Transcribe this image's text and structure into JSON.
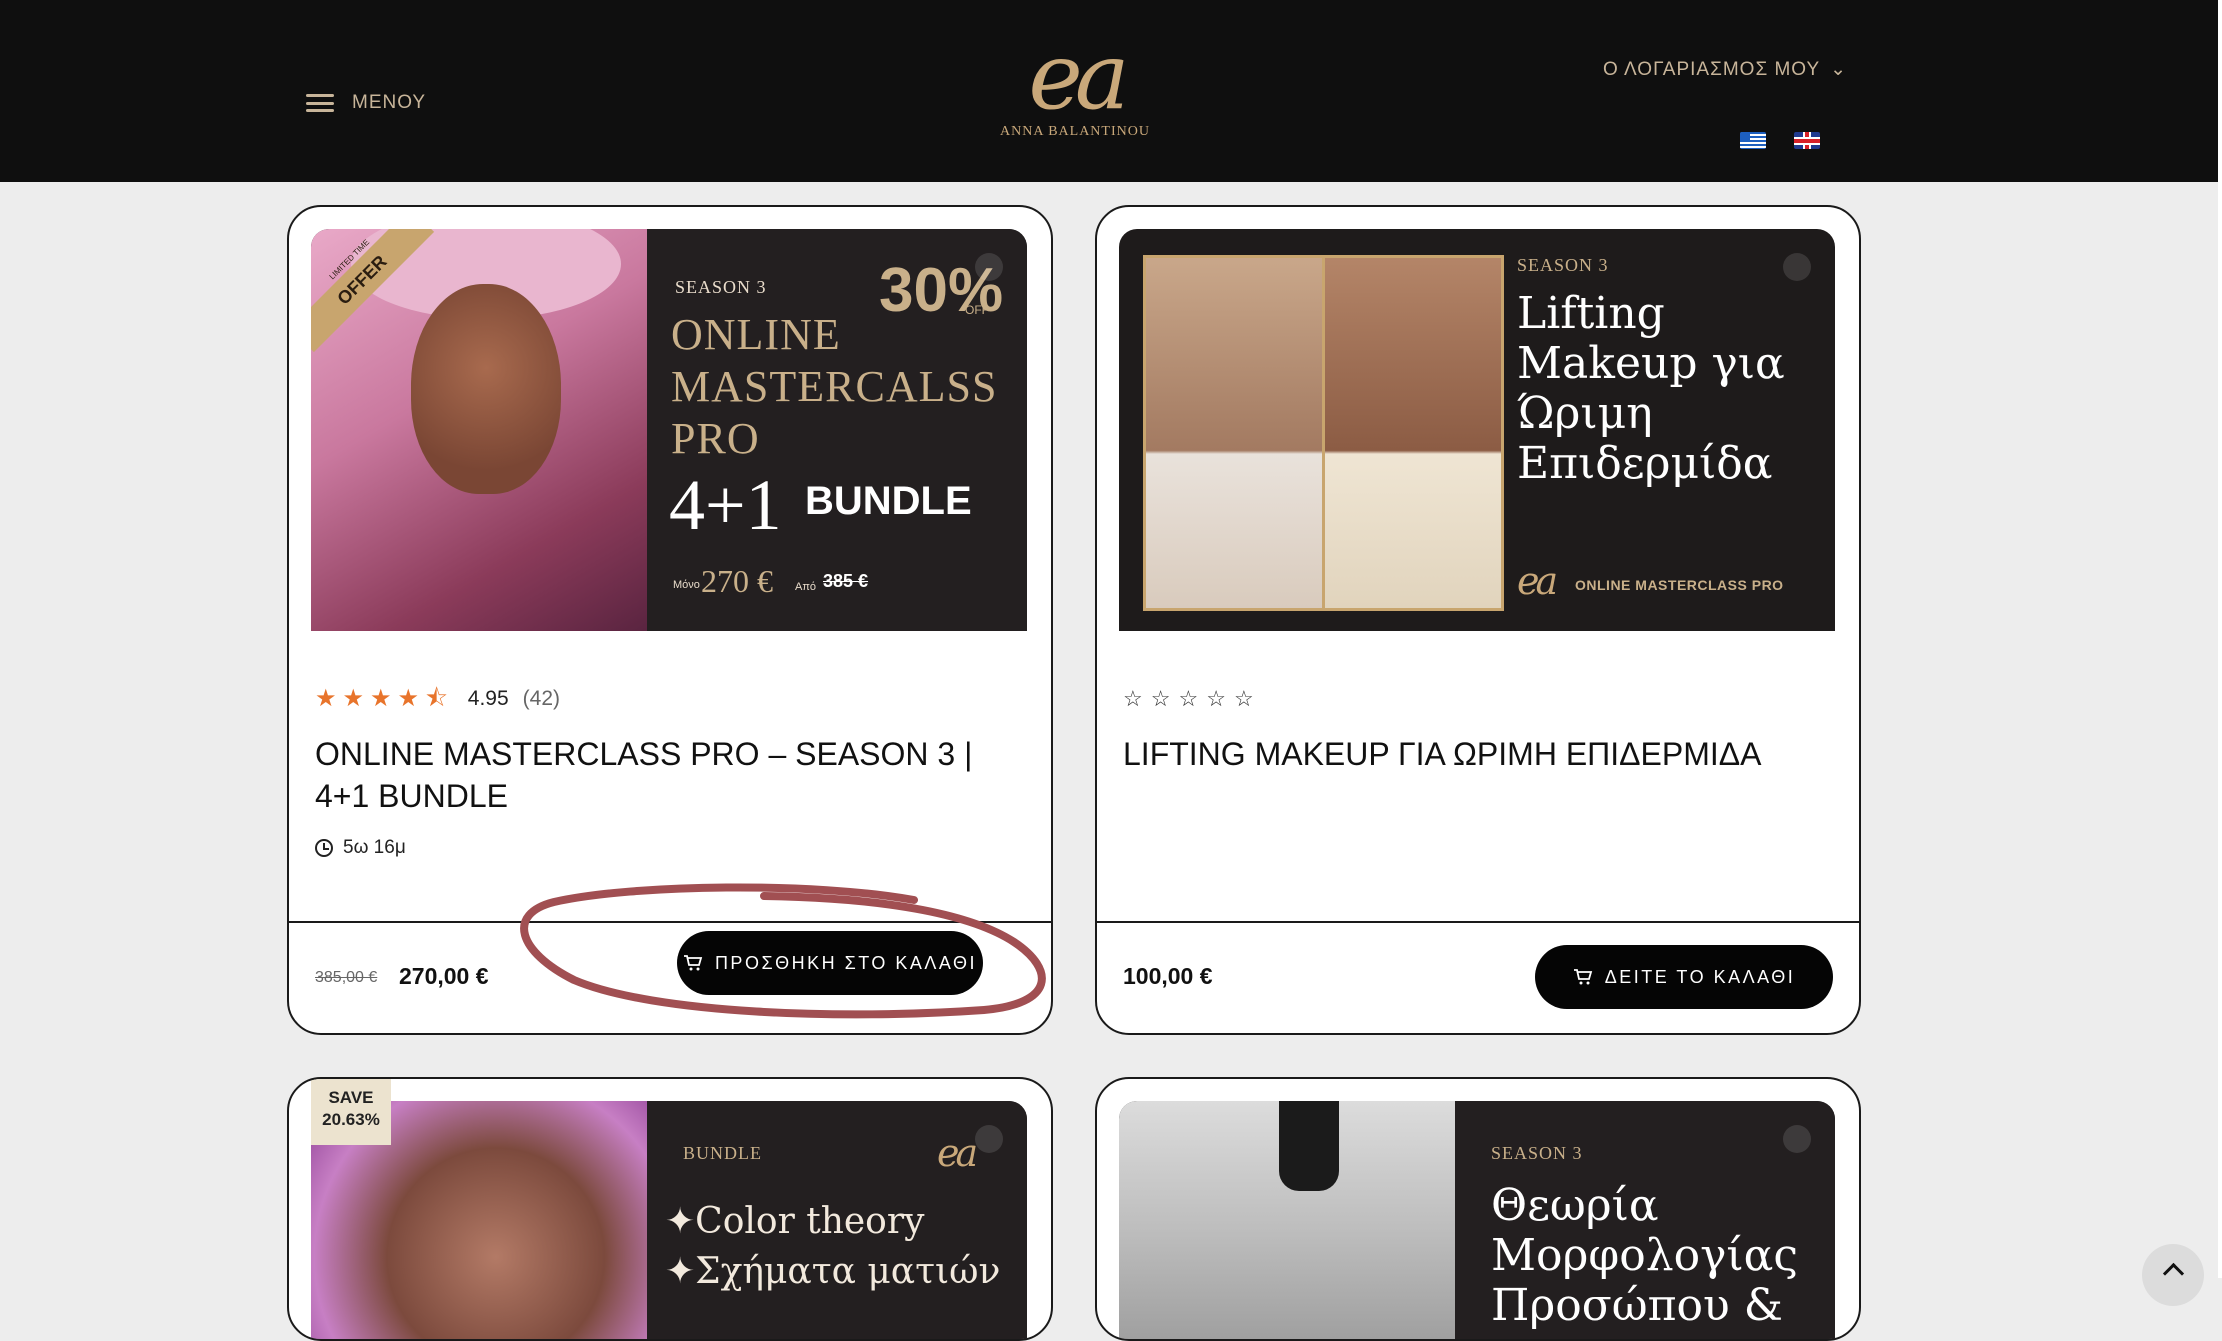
{
  "header": {
    "menu_label": "ΜΕΝΟΥ",
    "logo_mark": "ea",
    "logo_name": "ANNA BALANTINOU",
    "account_label": "Ο ΛΟΓΑΡΙΑΣΜΟΣ ΜΟΥ",
    "account_caret": "⌄"
  },
  "products": [
    {
      "image": {
        "ribbon_small": "LIMITED TIME",
        "ribbon": "OFFER",
        "season": "SEASON 3",
        "title_line1": "ONLINE",
        "title_line2": "MASTERCALSS",
        "title_line3": "PRO",
        "big": "4+1",
        "bundle": "BUNDLE",
        "percent": "30%",
        "off": "OFF",
        "only": "Μόνο",
        "price_now": "270 €",
        "from": "Από",
        "price_old": "385 €"
      },
      "rating": {
        "score": "4.95",
        "count": "(42)",
        "stars": [
          "full",
          "full",
          "full",
          "full",
          "half"
        ]
      },
      "title": "ONLINE MASTERCLASS PRO – SEASON 3 | 4+1 BUNDLE",
      "duration": "5ω 16μ",
      "price_old": "385,00 €",
      "price_now": "270,00 €",
      "button_label": "ΠΡΟΣΘΗΚΗ ΣΤΟ ΚΑΛΑΘΙ"
    },
    {
      "image": {
        "season": "SEASON 3",
        "title_line1": "Lifting",
        "title_line2": "Makeup για",
        "title_line3": "Ώριμη",
        "title_line4": "Επιδερμίδα",
        "logo": "ea",
        "masterclass": "ONLINE MASTERCLASS PRO"
      },
      "rating": {
        "stars": [
          "empty",
          "empty",
          "empty",
          "empty",
          "empty"
        ]
      },
      "title": "LIFTING MAKEUP ΓΙΑ ΩΡΙΜΗ ΕΠΙΔΕΡΜΙΔΑ",
      "price_now": "100,00 €",
      "button_label": "ΔΕΙΤΕ ΤΟ ΚΑΛΑΘΙ"
    },
    {
      "badge": {
        "line1": "SAVE",
        "line2": "20.63%"
      },
      "image": {
        "season": "BUNDLE",
        "logo": "ea",
        "line1": "✦Color theory",
        "line2": "✦Σχήματα ματιών"
      }
    },
    {
      "image": {
        "season": "SEASON 3",
        "line1": "Θεωρία",
        "line2": "Μορφολογίας",
        "line3": "Προσώπου &"
      }
    }
  ],
  "colors": {
    "header_bg": "#0f0f0f",
    "gold": "#c9a87a",
    "accent_star": "#e8742b",
    "button_bg": "#050505",
    "annotation": "#a14f52"
  }
}
